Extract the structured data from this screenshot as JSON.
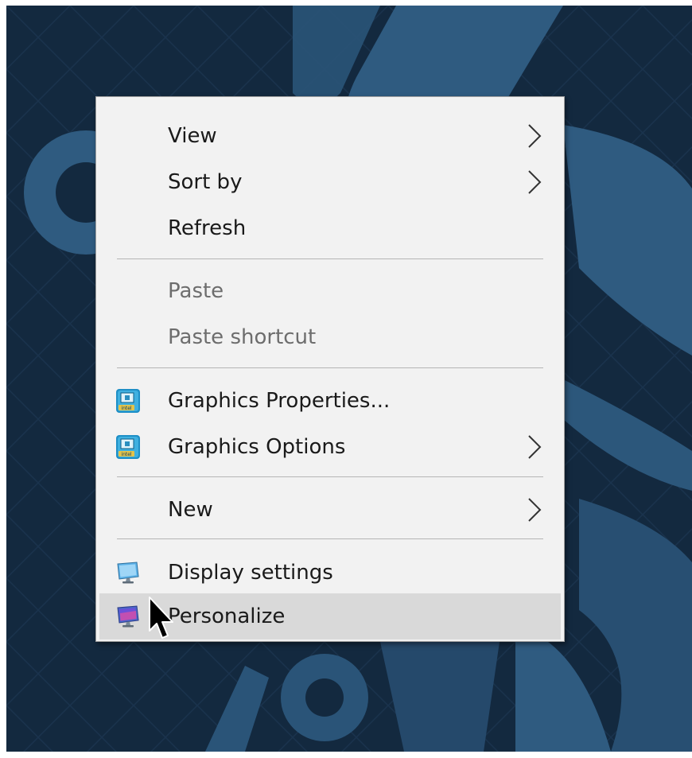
{
  "context_menu": {
    "items": [
      {
        "label": "View",
        "has_submenu": true,
        "enabled": true
      },
      {
        "label": "Sort by",
        "has_submenu": true,
        "enabled": true
      },
      {
        "label": "Refresh",
        "has_submenu": false,
        "enabled": true
      },
      {
        "label": "Paste",
        "has_submenu": false,
        "enabled": false
      },
      {
        "label": "Paste shortcut",
        "has_submenu": false,
        "enabled": false
      },
      {
        "label": "Graphics Properties...",
        "has_submenu": false,
        "enabled": true,
        "icon": "intel-graphics-icon"
      },
      {
        "label": "Graphics Options",
        "has_submenu": true,
        "enabled": true,
        "icon": "intel-graphics-icon"
      },
      {
        "label": "New",
        "has_submenu": true,
        "enabled": true
      },
      {
        "label": "Display settings",
        "has_submenu": false,
        "enabled": true,
        "icon": "display-settings-icon"
      },
      {
        "label": "Personalize",
        "has_submenu": false,
        "enabled": true,
        "icon": "personalize-icon",
        "hovered": true
      }
    ]
  },
  "colors": {
    "menu_background": "#f2f2f2",
    "hover_background": "#d9d9d9",
    "text": "#1a1a1a",
    "disabled_text": "#6d6d6d",
    "wallpaper_dark": "#0f2438",
    "wallpaper_shape": "#2e5a7e"
  }
}
